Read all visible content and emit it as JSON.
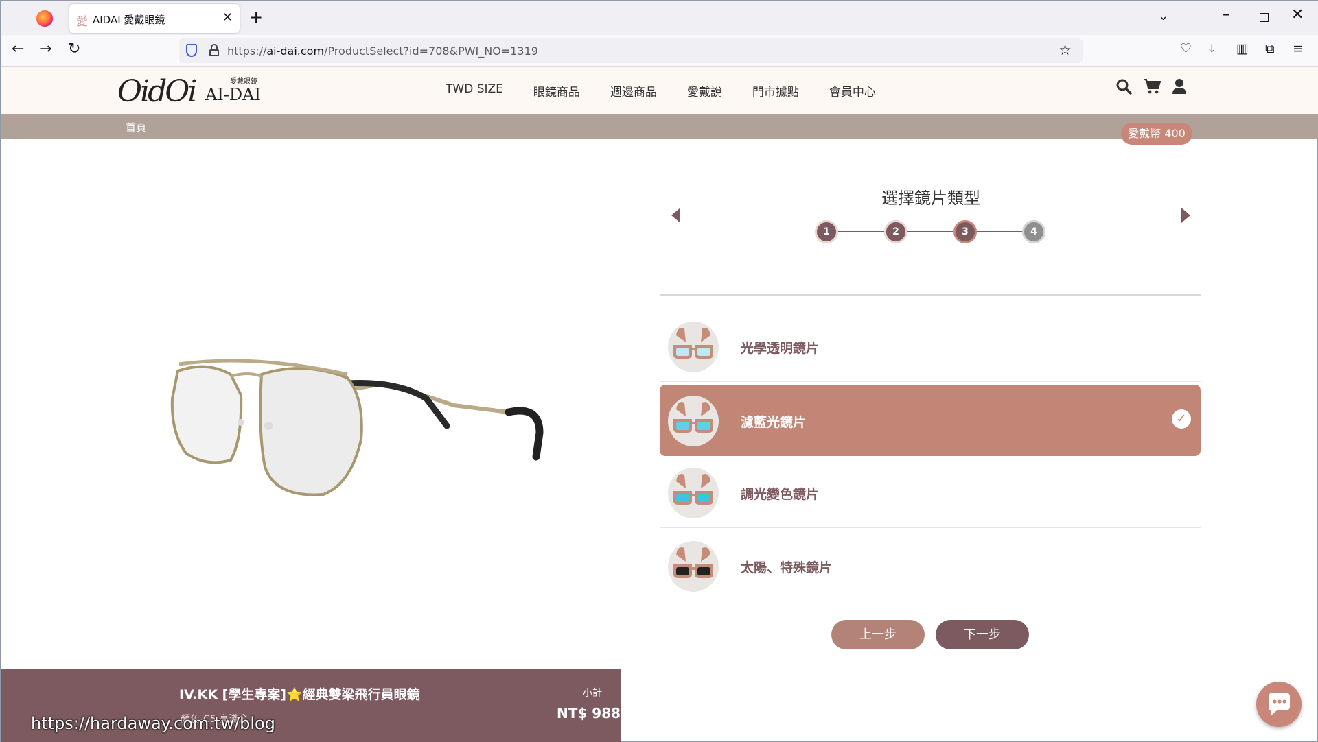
{
  "browser": {
    "tab_title": "AIDAI 愛戴眼鏡",
    "tab_favicon": "愛",
    "url_prefix": "https://",
    "url_domain": "ai-dai.com",
    "url_path": "/ProductSelect?id=708&PWI_NO=1319"
  },
  "header": {
    "logo_script": "OidOi",
    "logo_small": "愛戴眼鏡",
    "logo_name": "AI-DAI",
    "nav": [
      "TWD SIZE",
      "眼鏡商品",
      "週邊商品",
      "愛戴說",
      "門市據點",
      "會員中心"
    ]
  },
  "breadcrumb": {
    "home": "首頁"
  },
  "coin_badge": "愛戴幣 400",
  "selector": {
    "title": "選擇鏡片類型",
    "steps": [
      "1",
      "2",
      "3",
      "4"
    ],
    "current_step": 3,
    "options": [
      {
        "label": "光學透明鏡片",
        "lens_color": "#bfe9f2"
      },
      {
        "label": "濾藍光鏡片",
        "lens_color": "#5fd0e6"
      },
      {
        "label": "調光變色鏡片",
        "lens_color": "#3ec5de"
      },
      {
        "label": "太陽、特殊鏡片",
        "lens_color": "#222222"
      }
    ],
    "selected_index": 1,
    "prev_button": "上一步",
    "next_button": "下一步"
  },
  "product": {
    "name": "IV.KK [學生專案]⭐經典雙梁飛行員眼鏡",
    "color": "顏色-C5 亮淺金",
    "subtotal_label": "小計",
    "subtotal_value": "NT$ 988"
  },
  "watermark": "https://hardaway.com.tw/blog",
  "colors": {
    "brand_primary": "#7d5a5f",
    "brand_accent": "#c28677",
    "breadcrumb_bg": "#b0a199"
  }
}
